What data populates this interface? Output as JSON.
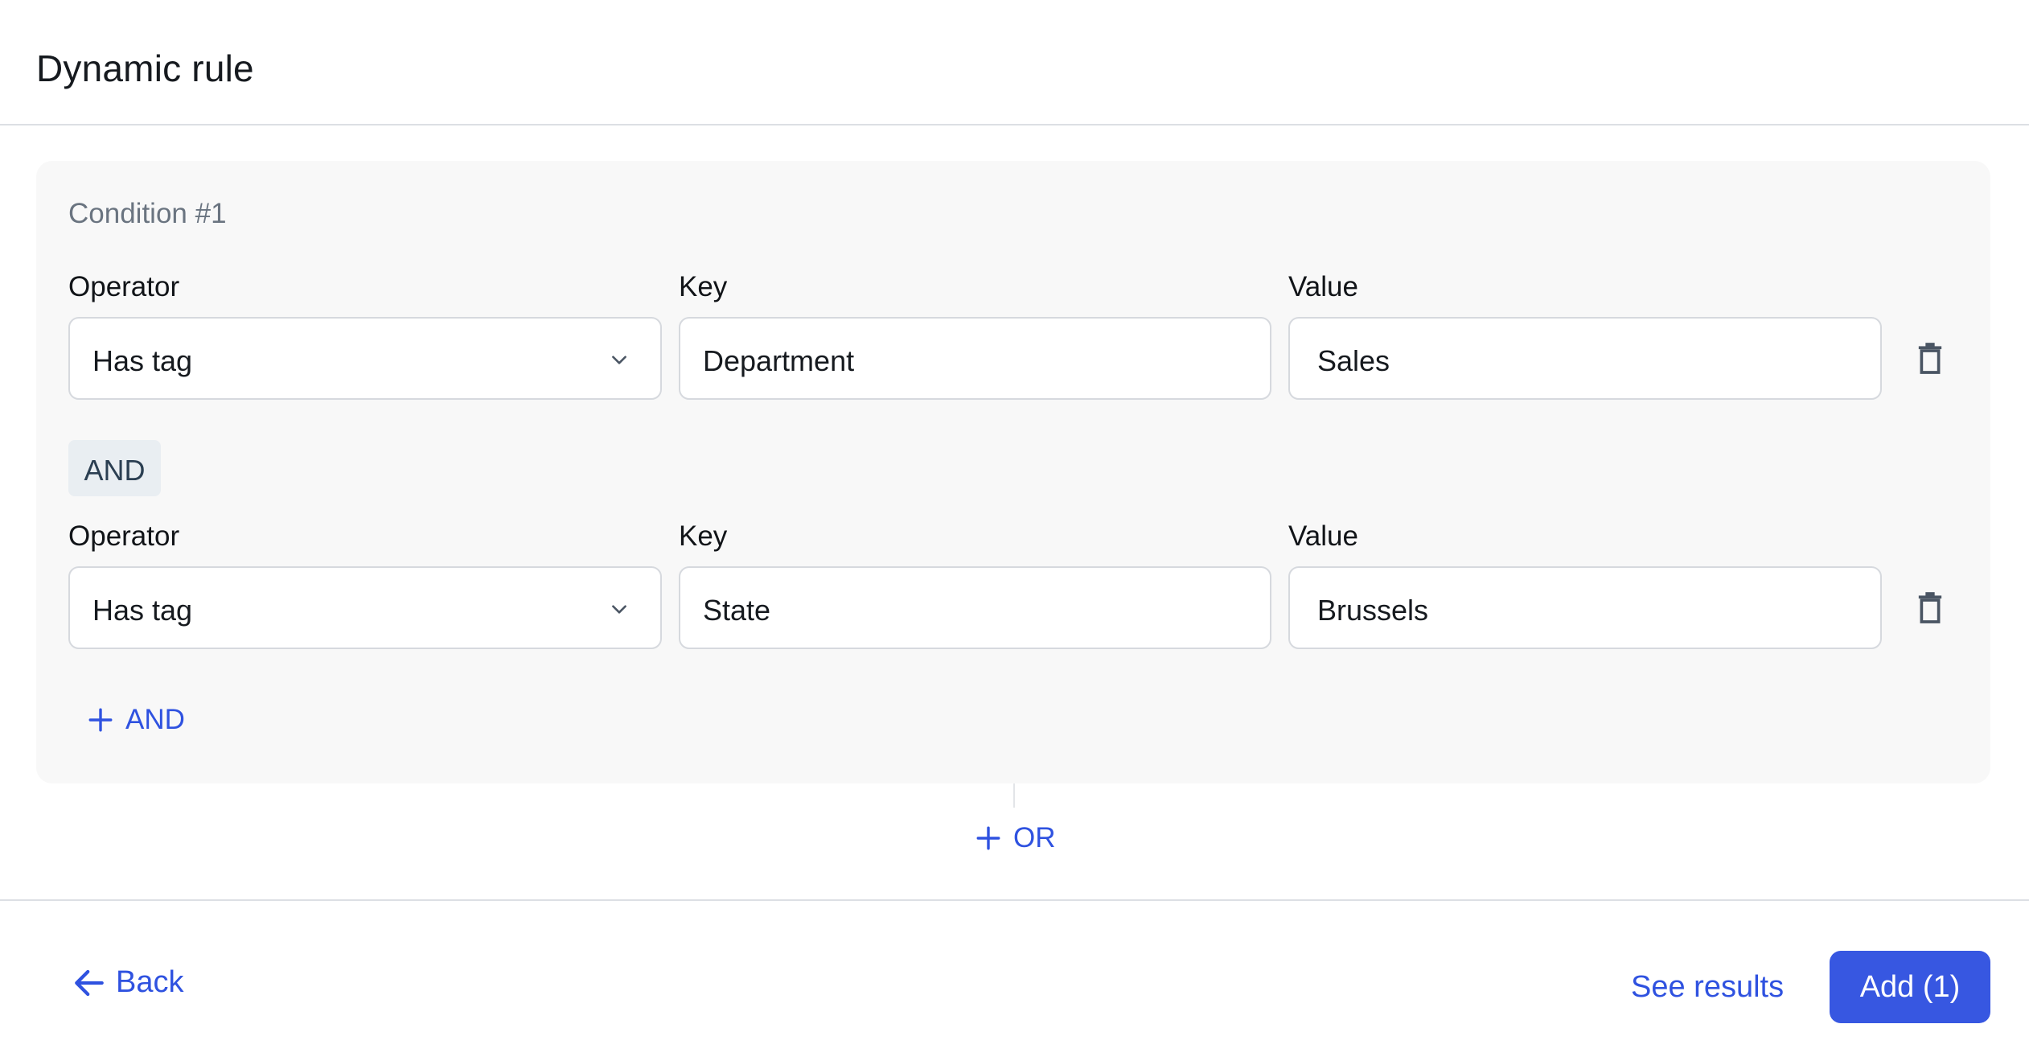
{
  "header": {
    "title": "Dynamic rule"
  },
  "condition": {
    "title": "Condition #1",
    "rows": [
      {
        "operator_label": "Operator",
        "operator_value": "Has tag",
        "key_label": "Key",
        "key_value": "Department",
        "value_label": "Value",
        "value_value": "Sales"
      },
      {
        "operator_label": "Operator",
        "operator_value": "Has tag",
        "key_label": "Key",
        "key_value": "State",
        "value_label": "Value",
        "value_value": "Brussels"
      }
    ],
    "and_chip": "AND",
    "add_and_label": "AND"
  },
  "add_or_label": "OR",
  "footer": {
    "back_label": "Back",
    "see_results_label": "See results",
    "add_label": "Add (1)"
  },
  "colors": {
    "accent": "#3757e1",
    "link": "#2f52e0",
    "panel_bg": "#f8f8f8",
    "chip_bg": "#e9eef2"
  },
  "icons": [
    "chevron-down-icon",
    "trash-icon",
    "plus-icon",
    "arrow-left-icon"
  ]
}
